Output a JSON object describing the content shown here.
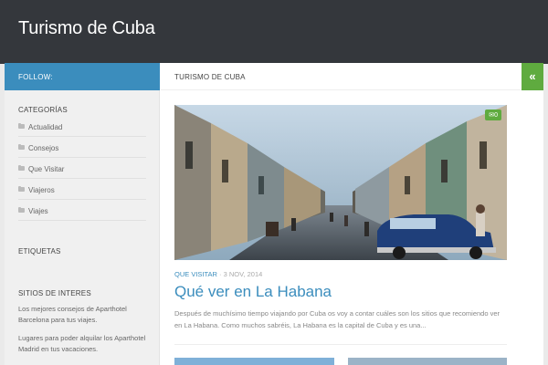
{
  "site": {
    "title": "Turismo de Cuba"
  },
  "sidebar": {
    "follow_label": "FOLLOW:",
    "categories_title": "CATEGORÍAS",
    "categories": [
      {
        "label": "Actualidad"
      },
      {
        "label": "Consejos"
      },
      {
        "label": "Que Visitar"
      },
      {
        "label": "Viajeros"
      },
      {
        "label": "Viajes"
      }
    ],
    "tags_title": "ETIQUETAS",
    "sites_title": "SITIOS DE INTERES",
    "sites": [
      {
        "text": "Los mejores consejos de Aparthotel Barcelona para tus viajes."
      },
      {
        "text": "Lugares para poder alquilar los Aparthotel Madrid en tus vacaciones."
      }
    ]
  },
  "main": {
    "breadcrumb": "TURISMO DE CUBA",
    "toggle_icon": "chevron-double-left-icon",
    "post": {
      "comment_count": "0",
      "category": "QUE VISITAR",
      "date": "3 NOV, 2014",
      "title": "Qué ver en La Habana",
      "excerpt": "Después de muchísimo tiempo viajando por Cuba os voy a contar cuáles son los sitios que recomiendo ver en La Habana. Como muchos sabréis, La Habana es la capital de Cuba y es una..."
    }
  },
  "colors": {
    "header": "#34373c",
    "accent": "#3b8dbd",
    "green": "#5fab3f",
    "sidebar_bg": "#f0f0f0"
  }
}
